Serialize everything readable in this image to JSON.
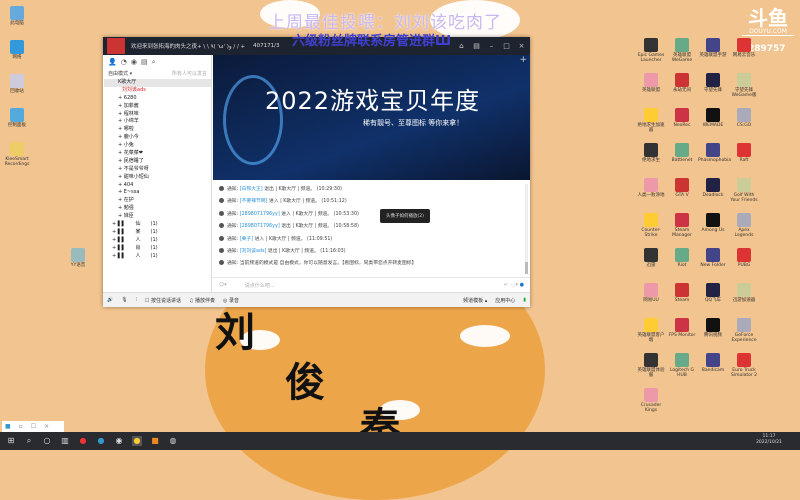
{
  "overlay": {
    "line1": "上周最佳投喂：刘刘该吃肉了",
    "line2": "六级粉丝牌联系房管进群Ш",
    "viewers": "289757"
  },
  "logo": {
    "big": "斗鱼",
    "small": "DOUYU.COM"
  },
  "bg_chars": [
    "刘",
    "俊",
    "秦"
  ],
  "left_icons": [
    "此电脑",
    "网络",
    "回收站",
    "控制面板",
    "KleeSmart Recordings"
  ],
  "user_icon": "YY语音",
  "right_icons": [
    "Epic Games Launcher",
    "英雄联盟WeGame",
    "英雄联盟手游",
    "网易云音乐",
    "英雄联盟",
    "永劫无间",
    "守望先锋",
    "守望先锋 WeGame版",
    "绝地求生加速器",
    "NeoRec",
    "WEMADE",
    "CS:GO",
    "绝地求生",
    "Battlenet",
    "Phasmophobia",
    "Raft",
    "人类一败涂地",
    "GTA V",
    "Deadlock",
    "Golf With Your Friends",
    "Counter-Strike",
    "Steam Manager",
    "Among Us",
    "Apex Legends",
    "迅雷",
    "Riot",
    "New Folder",
    "PUBG",
    "网易UU",
    "Steam",
    "QQ飞车",
    "迅游加速器",
    "英雄联盟客户端",
    "FPS Monitor",
    "腾讯视频",
    "GeForce Experience",
    "英雄联盟体验服",
    "Logitech G HUB",
    "Bandicam",
    "Euro Truck Simulator 2",
    "Crusader Kings"
  ],
  "window": {
    "title": "欢迎来到张拓海的肉头之夜+ \\ \\ ٩( 'ω' )و / / +",
    "channel_id": "407171/3",
    "side_mode": "自由模式 ▾",
    "side_hint": "所有人可以发言",
    "tree_header": "K歌大厅",
    "me": "刘刘该ads",
    "members": [
      "6280",
      "加菲酱",
      "程林味",
      "小绵羊",
      "哪啦",
      "鹿小今",
      "小兔",
      "花菜菜❤",
      "民宿睡了",
      "不是爷爷呀",
      "甜味小短仙",
      "404",
      "E~ssa",
      "在护",
      "勉强",
      "妹臣"
    ],
    "channels": [
      [
        "仙",
        "(1)"
      ],
      [
        "某",
        "(1)"
      ],
      [
        "人",
        "(1)"
      ],
      [
        "肖",
        "(1)"
      ],
      [
        "人",
        "(1)"
      ]
    ],
    "banner_title": "2022游戏宝贝年度",
    "banner_sub": "稀有靓号、至尊图标 等你来拿！",
    "messages": [
      {
        "p": "通知:",
        "u": "[白熊大王]",
        "a": "退出 | K歌大厅 | 频道。",
        "t": "(10:29:30)"
      },
      {
        "p": "通知:",
        "u": "[不要辣节啊]",
        "a": "进入 | K歌大厅 | 频道。",
        "t": "(10:51:12)"
      },
      {
        "p": "通知:",
        "u": "[2898071796yy]",
        "a": "进入 | K歌大厅 | 频道。",
        "t": "(10:53:30)"
      },
      {
        "p": "通知:",
        "u": "[2898071796yy]",
        "a": "退出 | K歌大厅 | 频道。",
        "t": "(10:58:58)"
      },
      {
        "p": "通知:",
        "u": "[栗子]",
        "a": "进入 | K歌大厅 | 频道。",
        "t": "(11:09:51)"
      },
      {
        "p": "通知:",
        "u": "[刘刘该ads]",
        "a": "退出 | K歌大厅 | 频道。",
        "t": "(11:16:03)"
      },
      {
        "p": "通知:",
        "u": "",
        "a": "当前频道的模式是 自由模式，你可以随意发言。【看图标，同类带您点开转麦图标】",
        "t": ""
      }
    ],
    "tooltip": "头像子如何播放(2)",
    "input_placeholder": "说点什么吧...",
    "bottom": {
      "hold": "按住说话讲话",
      "music": "播放伴奏",
      "record": "录音",
      "template": "频道模板 ▴",
      "apps": "应用中心"
    }
  },
  "taskbar": {
    "time": "11:17",
    "date": "2022/10/21"
  }
}
